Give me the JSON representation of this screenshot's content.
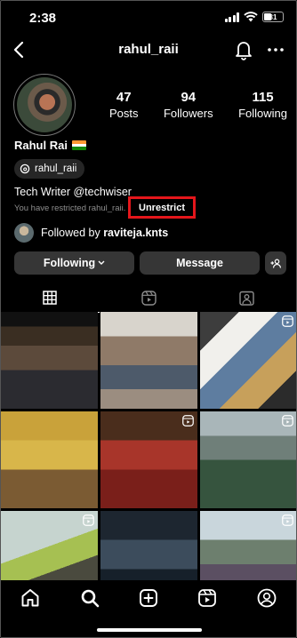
{
  "status_bar": {
    "time": "2:38",
    "battery": "31"
  },
  "header": {
    "username": "rahul_raii"
  },
  "profile": {
    "stats": [
      {
        "num": "47",
        "label": "Posts"
      },
      {
        "num": "94",
        "label": "Followers"
      },
      {
        "num": "115",
        "label": "Following"
      }
    ],
    "display_name": "Rahul Rai",
    "threads_handle": "rahul_raii",
    "bio": "Tech Writer @techwiser",
    "restricted_text": "You have restricted rahul_raii.",
    "unrestrict_label": "Unrestrict",
    "followed_by_prefix": "Followed by",
    "followed_by_user": "raviteja.knts"
  },
  "buttons": {
    "following_label": "Following",
    "message_label": "Message"
  },
  "tabs": [
    "grid-icon",
    "reels-icon",
    "tagged-icon"
  ],
  "grid_reels": [
    false,
    false,
    true,
    false,
    true,
    true,
    true,
    false,
    true
  ],
  "bottom_nav": [
    "home-icon",
    "search-icon",
    "create-icon",
    "reels-icon",
    "profile-icon"
  ],
  "colors": {
    "highlight": "#e4161b",
    "button_bg": "#363636",
    "background": "#000000"
  }
}
